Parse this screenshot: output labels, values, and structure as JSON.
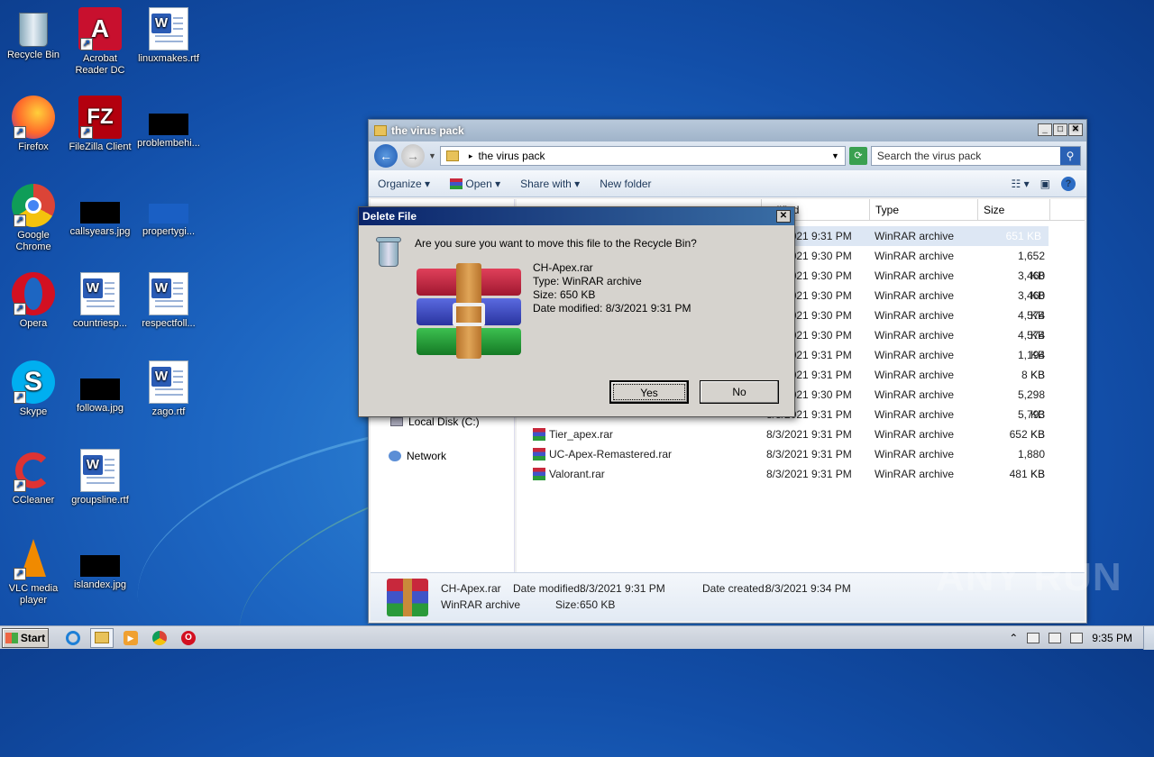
{
  "desktop": {
    "icons": [
      {
        "label": "Recycle Bin"
      },
      {
        "label": "Acrobat Reader DC"
      },
      {
        "label": "linuxmakes.rtf"
      },
      {
        "label": "Firefox"
      },
      {
        "label": "FileZilla Client"
      },
      {
        "label": "problembehi..."
      },
      {
        "label": "Google Chrome"
      },
      {
        "label": "callsyears.jpg"
      },
      {
        "label": "propertygi..."
      },
      {
        "label": "Opera"
      },
      {
        "label": "countriesp..."
      },
      {
        "label": "respectfoll..."
      },
      {
        "label": "Skype"
      },
      {
        "label": "followa.jpg"
      },
      {
        "label": "zago.rtf"
      },
      {
        "label": "CCleaner"
      },
      {
        "label": "groupsline.rtf"
      },
      {
        "label": "VLC media player"
      },
      {
        "label": "islandex.jpg"
      }
    ]
  },
  "explorer": {
    "title": "the virus pack",
    "address": "the virus pack",
    "search_placeholder": "Search the virus pack",
    "toolbar": {
      "organize": "Organize",
      "open": "Open",
      "share": "Share with",
      "new_folder": "New folder"
    },
    "nav": {
      "local_disk": "Local Disk (C:)",
      "network": "Network"
    },
    "columns": {
      "modified": "odified",
      "type": "Type",
      "size": "Size"
    },
    "rows": [
      {
        "name": "",
        "date": "8/3/2021 9:31 PM",
        "type": "WinRAR archive",
        "size": "651 KB"
      },
      {
        "name": "",
        "date": "8/3/2021 9:30 PM",
        "type": "WinRAR archive",
        "size": "1,652 KB"
      },
      {
        "name": "",
        "date": "8/3/2021 9:30 PM",
        "type": "WinRAR archive",
        "size": "3,460 KB"
      },
      {
        "name": "",
        "date": "8/3/2021 9:30 PM",
        "type": "WinRAR archive",
        "size": "3,460 KB"
      },
      {
        "name": "",
        "date": "8/3/2021 9:30 PM",
        "type": "WinRAR archive",
        "size": "4,574 KB"
      },
      {
        "name": "",
        "date": "8/3/2021 9:30 PM",
        "type": "WinRAR archive",
        "size": "4,574 KB"
      },
      {
        "name": "",
        "date": "8/3/2021 9:31 PM",
        "type": "WinRAR archive",
        "size": "1,194 KB"
      },
      {
        "name": "",
        "date": "8/3/2021 9:31 PM",
        "type": "WinRAR archive",
        "size": "8 KB"
      },
      {
        "name": "",
        "date": "8/3/2021 9:30 PM",
        "type": "WinRAR archive",
        "size": "5,298 KB"
      },
      {
        "name": "",
        "date": "8/3/2021 9:31 PM",
        "type": "WinRAR archive",
        "size": "5,793 KB"
      },
      {
        "name": "Tier_apex.rar",
        "date": "8/3/2021 9:31 PM",
        "type": "WinRAR archive",
        "size": "652 KB"
      },
      {
        "name": "UC-Apex-Remastered.rar",
        "date": "8/3/2021 9:31 PM",
        "type": "WinRAR archive",
        "size": "1,880 KB"
      },
      {
        "name": "Valorant.rar",
        "date": "8/3/2021 9:31 PM",
        "type": "WinRAR archive",
        "size": "481 KB"
      }
    ],
    "details": {
      "name": "CH-Apex.rar",
      "type": "WinRAR archive",
      "modified_label": "Date modified:",
      "modified": "8/3/2021 9:31 PM",
      "size_label": "Size:",
      "size": "650 KB",
      "created_label": "Date created:",
      "created": "8/3/2021 9:34 PM"
    }
  },
  "dialog": {
    "title": "Delete File",
    "question": "Are you sure you want to move this file to the Recycle Bin?",
    "file_name": "CH-Apex.rar",
    "file_type": "Type: WinRAR archive",
    "file_size": "Size: 650 KB",
    "file_modified": "Date modified: 8/3/2021 9:31 PM",
    "yes": "Yes",
    "no": "No"
  },
  "taskbar": {
    "start": "Start",
    "clock": "9:35 PM"
  },
  "watermark": "ANY RUN"
}
